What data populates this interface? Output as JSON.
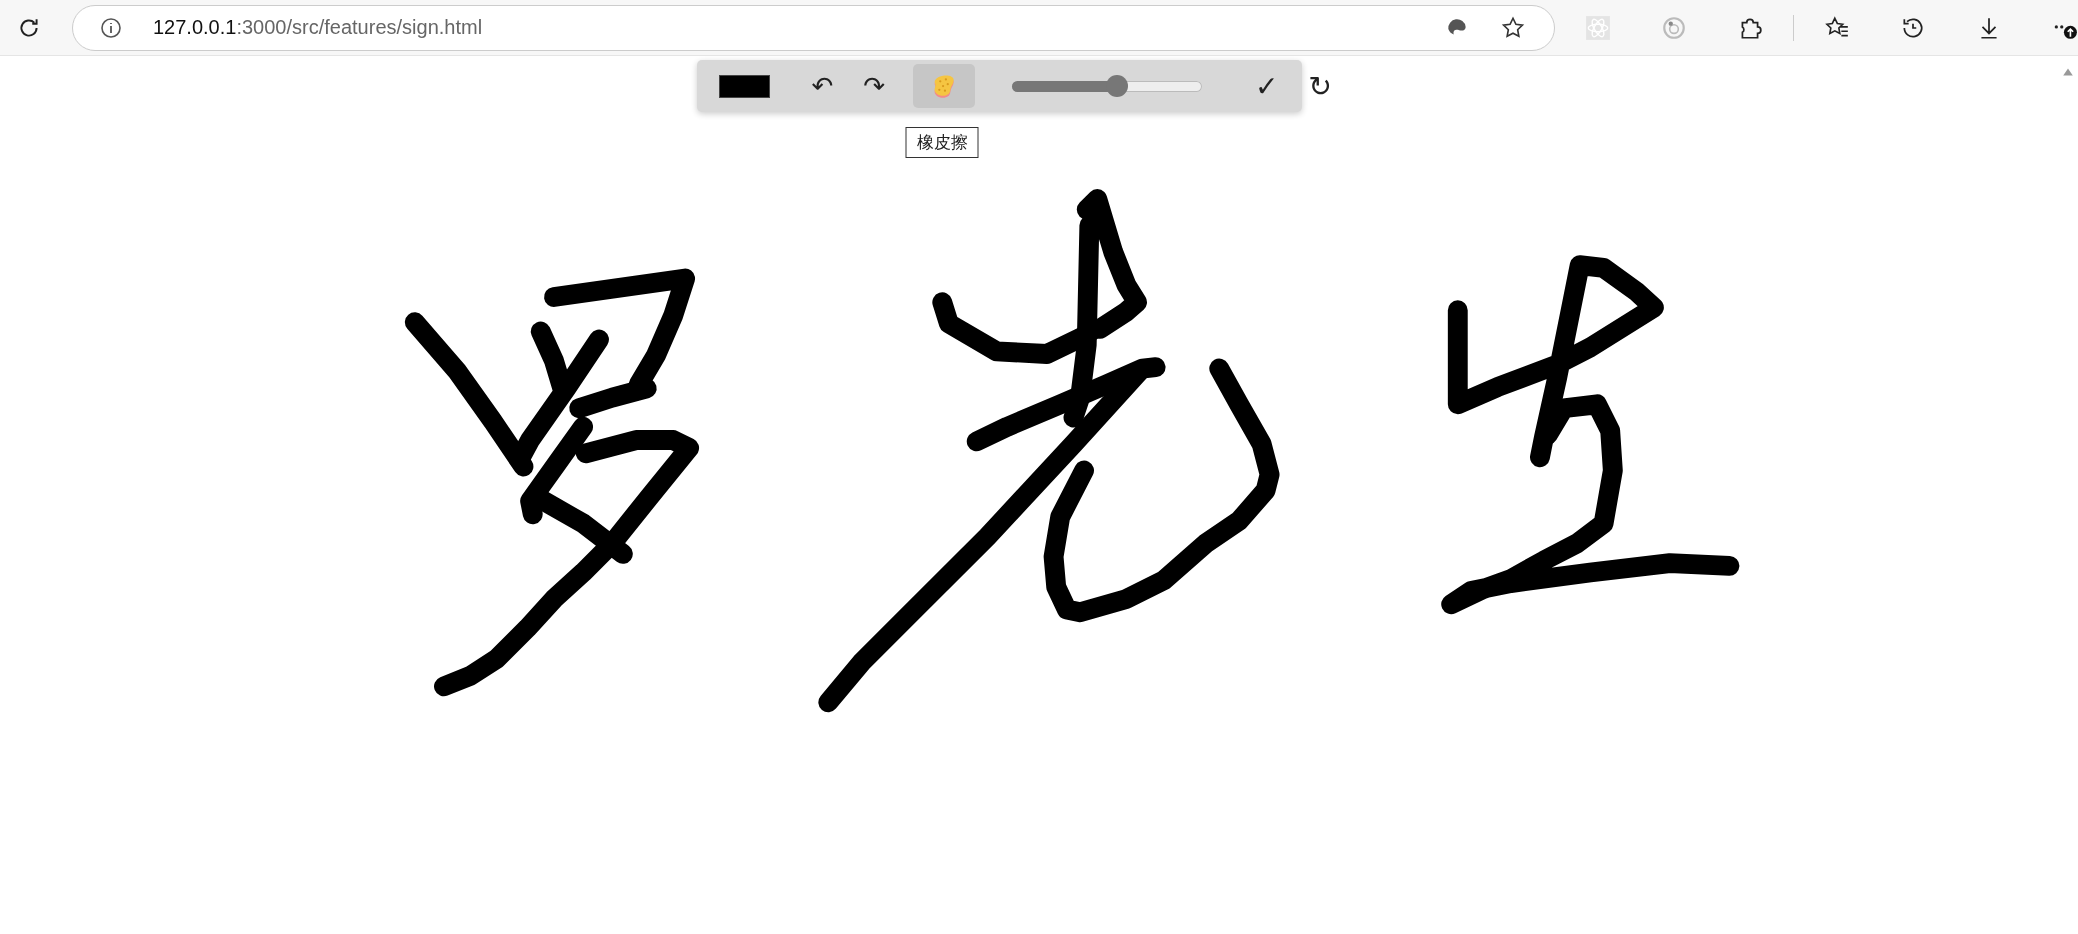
{
  "browser": {
    "url_host": "127.0.0.1",
    "url_rest": ":3000/src/features/sign.html"
  },
  "toolbar": {
    "history_buttons": [
      {
        "label": "↶"
      },
      {
        "label": "↷"
      }
    ],
    "eraser": {
      "selected": true,
      "tooltip": "橡皮擦"
    },
    "stroke_width": {
      "level": 0.55
    },
    "action_buttons": [
      {
        "label": "✓"
      },
      {
        "label": "↻"
      }
    ]
  }
}
